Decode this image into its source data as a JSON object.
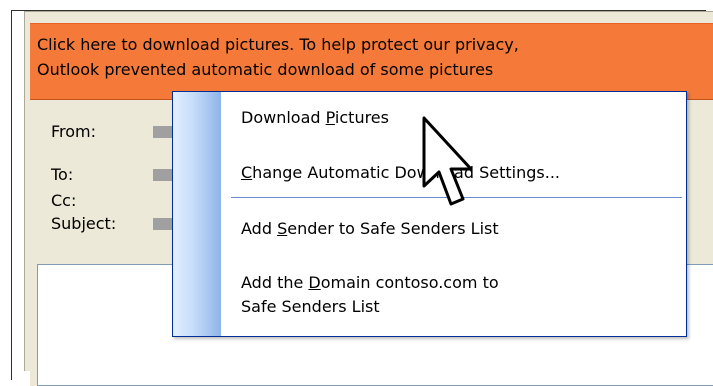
{
  "infobar": {
    "line1": "Click here to download pictures. To help protect our privacy,",
    "line2": "Outlook prevented automatic download of some pictures"
  },
  "header_fields": {
    "from_label": "From:",
    "to_label": "To:",
    "cc_label": "Cc:",
    "subject_label": "Subject:"
  },
  "context_menu": {
    "items": [
      {
        "before": "Download ",
        "key": "P",
        "after": "ictures"
      },
      {
        "before": "",
        "key": "C",
        "after": "hange Automatic Download Settings..."
      },
      {
        "before": "Add ",
        "key": "S",
        "after": "ender to Safe Senders List"
      },
      {
        "before": "Add the ",
        "key": "D",
        "after": "omain contoso.com to",
        "line2": "Safe Senders List"
      }
    ]
  },
  "colors": {
    "infobar_bg": "#f57a3a",
    "menu_border": "#002d96",
    "menu_gutter": "#c4dbf8",
    "window_bg": "#ece9d8"
  },
  "icons": [
    "mouse-pointer-icon"
  ]
}
